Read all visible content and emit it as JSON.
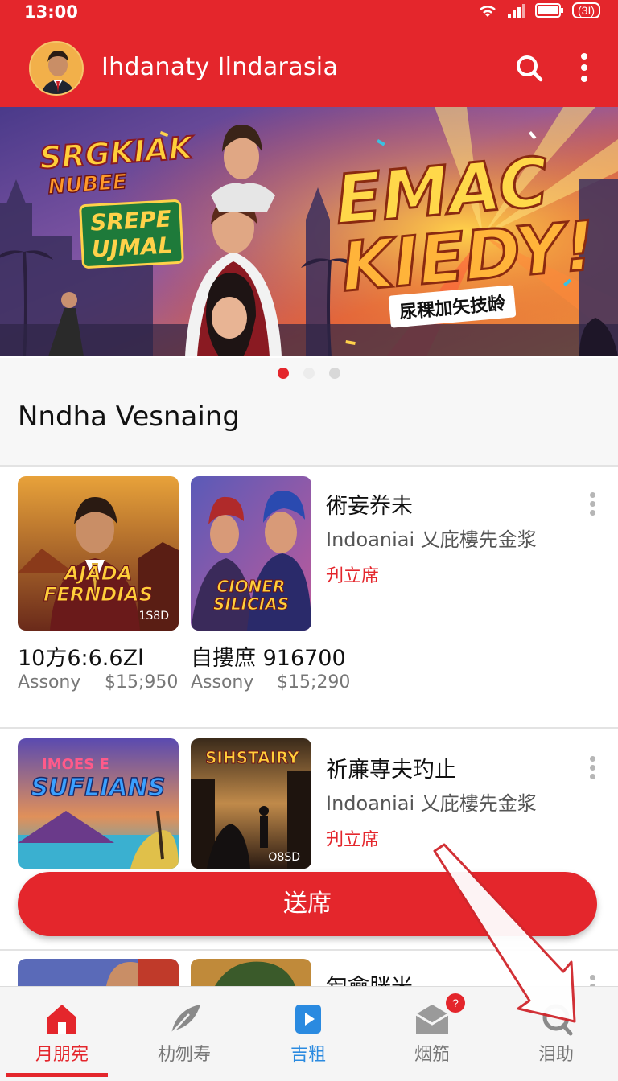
{
  "status_bar": {
    "time": "13:00",
    "battery": "(3I)"
  },
  "header": {
    "title": "Ihdanaty Ilndarasia",
    "search_icon": "search-icon",
    "more_icon": "more-vertical-icon"
  },
  "banner": {
    "logo_line1": "SRGKIAK",
    "logo_line2": "NUBEE",
    "logo2_line1": "SREPE",
    "logo2_line2": "UJMAL",
    "headline_line1": "EMAC",
    "headline_line2": "KIEDY!",
    "ribbon": "尿稞加矢技龄",
    "pages": 3,
    "active_page": 1
  },
  "section": {
    "title": "Nndha Vesnaing"
  },
  "rows": [
    {
      "thumb1_label": "AJADA FERNDIAS",
      "thumb1_badge": "1S8D",
      "thumb2_label": "CIONER SILICIAS",
      "title": "術妄奍未",
      "subtitle": "Indoaniai 乂庇樓先金浆",
      "tag": "刋立席",
      "price1_title": "10方6:6.6Zl",
      "price1_seller": "Assony",
      "price1_amount": "$15;950",
      "price2_title": "自摟庶 916700",
      "price2_seller": "Assony",
      "price2_amount": "$15;290"
    },
    {
      "thumb1_label": "SUFLIANS",
      "thumb1_top": "IMOES E",
      "thumb2_label": "SIHSTAIRY",
      "thumb2_badge": "O8SD",
      "title": "祈亷専夫玓止",
      "subtitle": "Indoaniai 乂庇樓先金浆",
      "tag": "刋立席"
    },
    {
      "title": "匄龠胱米"
    }
  ],
  "cta": {
    "label": "送席"
  },
  "bottom_nav": [
    {
      "label": "月朋宪",
      "icon": "home-icon",
      "active": true
    },
    {
      "label": "朸刎寿",
      "icon": "feather-icon",
      "active": false
    },
    {
      "label": "吉粗",
      "icon": "play-icon",
      "active": false
    },
    {
      "label": "烟笳",
      "icon": "inbox-icon",
      "active": false,
      "badge": "?"
    },
    {
      "label": "泪助",
      "icon": "search-icon",
      "active": false
    }
  ],
  "colors": {
    "accent": "#e4262c",
    "nav_inactive": "#777777"
  }
}
